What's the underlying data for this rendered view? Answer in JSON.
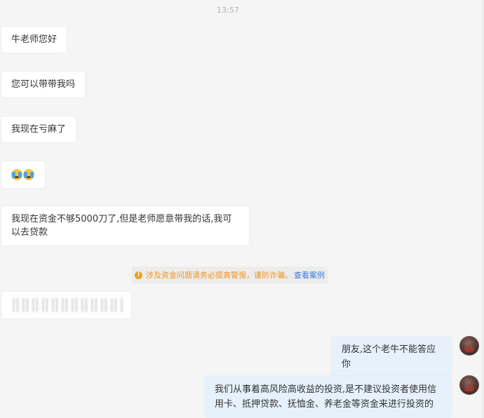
{
  "chat": {
    "timestamp": "13:57",
    "incoming": [
      {
        "text": "牛老师您好"
      },
      {
        "text": "您可以带带我吗"
      },
      {
        "text": "我现在亏麻了"
      },
      {
        "emoji": [
          "crying-face-emoji",
          "crying-face-emoji"
        ]
      },
      {
        "text": "我现在资金不够5000刀了,但是老师愿意带我的话,我可以去贷款"
      }
    ],
    "notice": {
      "icon": "warning-icon",
      "text": "涉及资金问题请务必提高警惕，谨防诈骗。",
      "link": "查看案例"
    },
    "outgoing": [
      {
        "text": "朋友,这个老牛不能答应你"
      },
      {
        "text": "我们从事着高风险高收益的投资,是不建议投资者使用信用卡、抵押贷款、抚恤金、养老金等资金来进行投资的"
      }
    ]
  },
  "colors": {
    "background": "#f5f5f5",
    "incoming_bubble": "#ffffff",
    "outgoing_bubble": "#e6f1fb",
    "notice_text": "#f0961e",
    "notice_link": "#3a7bd5"
  }
}
